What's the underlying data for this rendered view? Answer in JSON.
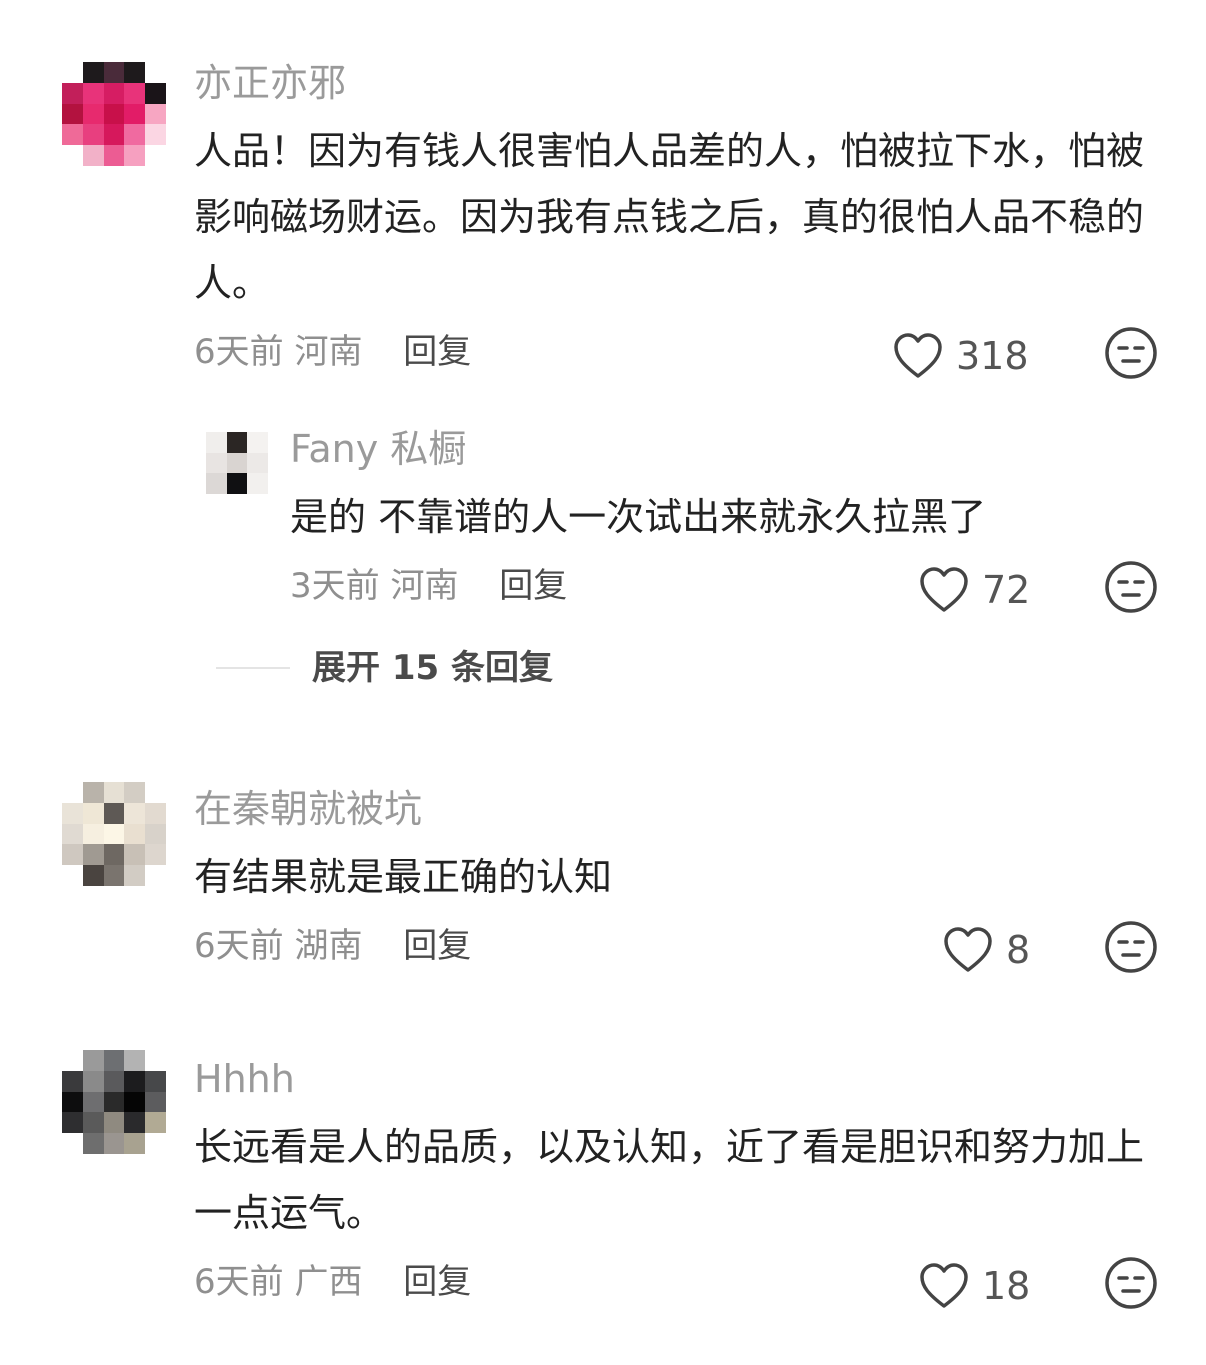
{
  "comments": [
    {
      "user": "亦正亦邪",
      "text": "人品！因为有钱人很害怕人品差的人，怕被拉下水，怕被影响磁场财运。因为我有点钱之后，真的很怕人品不稳的人。",
      "time": "6天前",
      "location": "河南",
      "reply_label": "回复",
      "likes": "318",
      "replies": [
        {
          "user": "Fany 私橱",
          "text": "是的 不靠谱的人一次试出来就永久拉黑了",
          "time": "3天前",
          "location": "河南",
          "reply_label": "回复",
          "likes": "72"
        }
      ],
      "expand_label": "展开 15 条回复"
    },
    {
      "user": "在秦朝就被坑",
      "text": "有结果就是最正确的认知",
      "time": "6天前",
      "location": "湖南",
      "reply_label": "回复",
      "likes": "8"
    },
    {
      "user": "Hhhh",
      "text": "长远看是人的品质，以及认知，近了看是胆识和努力加上一点运气。",
      "time": "6天前",
      "location": "广西",
      "reply_label": "回复",
      "likes": "18"
    }
  ],
  "icons": {
    "like": "heart-outline-icon",
    "dislike": "unamused-face-icon"
  }
}
